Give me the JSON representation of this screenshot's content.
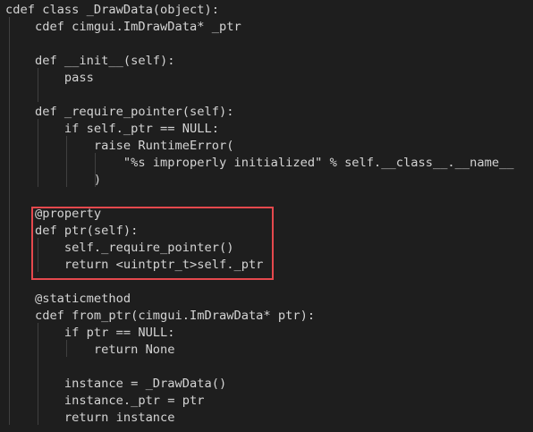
{
  "editor": {
    "lines": [
      "cdef class _DrawData(object):",
      "    cdef cimgui.ImDrawData* _ptr",
      "",
      "    def __init__(self):",
      "        pass",
      "",
      "    def _require_pointer(self):",
      "        if self._ptr == NULL:",
      "            raise RuntimeError(",
      "                \"%s improperly initialized\" % self.__class__.__name__",
      "            )",
      "",
      "    @property",
      "    def ptr(self):",
      "        self._require_pointer()",
      "        return <uintptr_t>self._ptr",
      "",
      "    @staticmethod",
      "    cdef from_ptr(cimgui.ImDrawData* ptr):",
      "        if ptr == NULL:",
      "            return None",
      "",
      "        instance = _DrawData()",
      "        instance._ptr = ptr",
      "        return instance"
    ]
  },
  "colors": {
    "background": "#1e1e1e",
    "text": "#d4d4d4",
    "keyword": "#569cd6",
    "function": "#dcdcaa",
    "class": "#4ec9b0",
    "string": "#ce9178",
    "highlight_border": "#e5484d",
    "indent_guide": "#404040"
  }
}
